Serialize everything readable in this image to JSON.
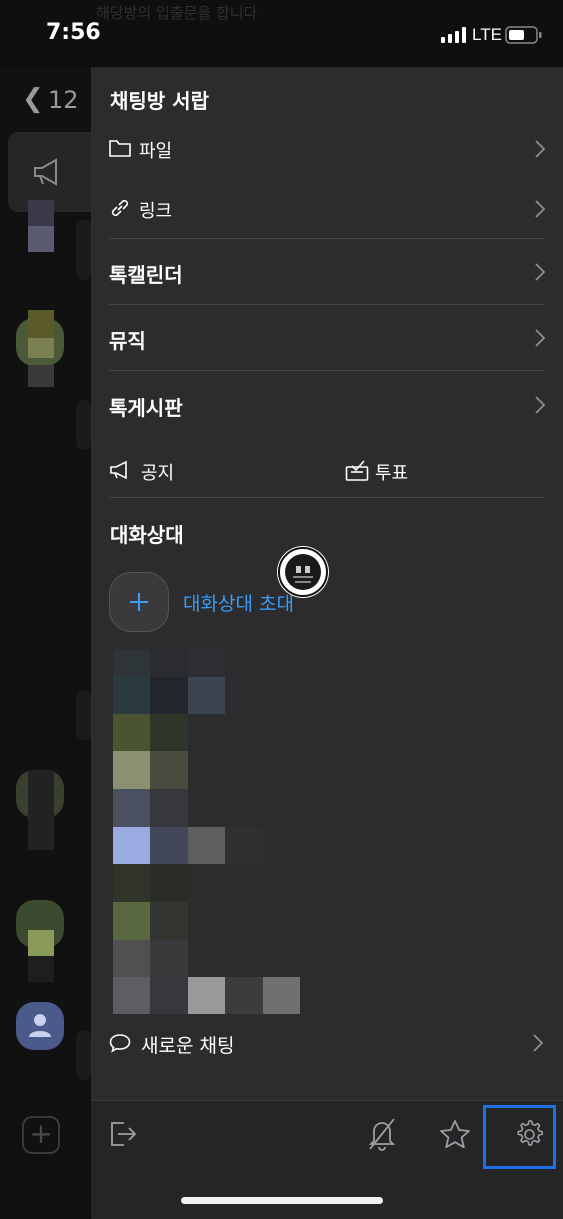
{
  "status_bar": {
    "time": "7:56",
    "network": "LTE"
  },
  "background_chat": {
    "unread_count": "12",
    "faint_title": "해당방의 입출문을 합니다"
  },
  "drawer": {
    "title": "채팅방 서랍",
    "items": [
      {
        "label": "파일",
        "icon": "folder-icon"
      },
      {
        "label": "링크",
        "icon": "link-icon"
      },
      {
        "label": "톡캘린더"
      },
      {
        "label": "뮤직"
      },
      {
        "label": "톡게시판"
      }
    ],
    "notice_label": "공지",
    "vote_label": "투표",
    "members_title": "대화상대",
    "invite_label": "대화상대 초대",
    "new_chat_label": "새로운 채팅"
  },
  "bottom_bar": {
    "exit_icon": "exit-icon",
    "mute_icon": "bell-slash-icon",
    "favorite_icon": "star-icon",
    "settings_icon": "gear-icon"
  },
  "colors": {
    "accent": "#3a9cf5",
    "highlight": "#1f6fe8",
    "drawer_bg": "#2c2c2e"
  }
}
